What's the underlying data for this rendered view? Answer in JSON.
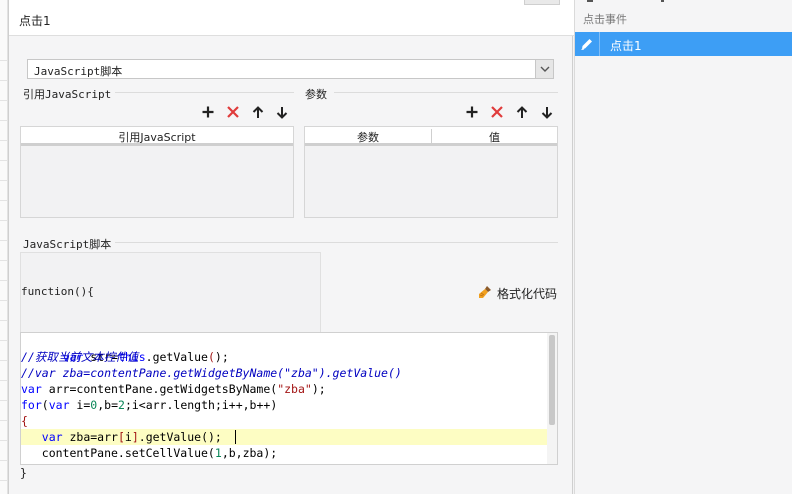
{
  "dialog": {
    "title": "点击1"
  },
  "type_select": {
    "value": "JavaScript脚本"
  },
  "js_refs": {
    "section_label": "引用JavaScript",
    "column_header": "引用JavaScript"
  },
  "params": {
    "section_label": "参数",
    "columns": [
      "参数",
      "值"
    ]
  },
  "toolbar_icons": [
    "add-icon",
    "delete-icon",
    "move-up-icon",
    "move-down-icon"
  ],
  "script": {
    "section_label": "JavaScript脚本",
    "function_header": "function(){",
    "format_button": "格式化代码",
    "lines": [
      "var str=this.getValue();",
      "//获取当前文本控件值",
      "//var zba=contentPane.getWidgetByName(\"zba\").getValue()",
      "var arr=contentPane.getWidgetsByName(\"zba\");",
      "for(var i=0,b=2;i<arr.length;i++,b++)",
      "{",
      "   var zba=arr[i].getValue();",
      "   contentPane.setCellValue(1,b,zba);"
    ],
    "highlighted_line": 6,
    "closing": "}"
  },
  "events": {
    "header": "点击事件",
    "items": [
      {
        "label": "点击1",
        "selected": true
      }
    ]
  },
  "colors": {
    "accent": "#3d9ef5",
    "delete": "#e03b3b",
    "keyword": "#0000ff",
    "string": "#a31515",
    "comment": "#0000c0",
    "number": "#098658"
  }
}
